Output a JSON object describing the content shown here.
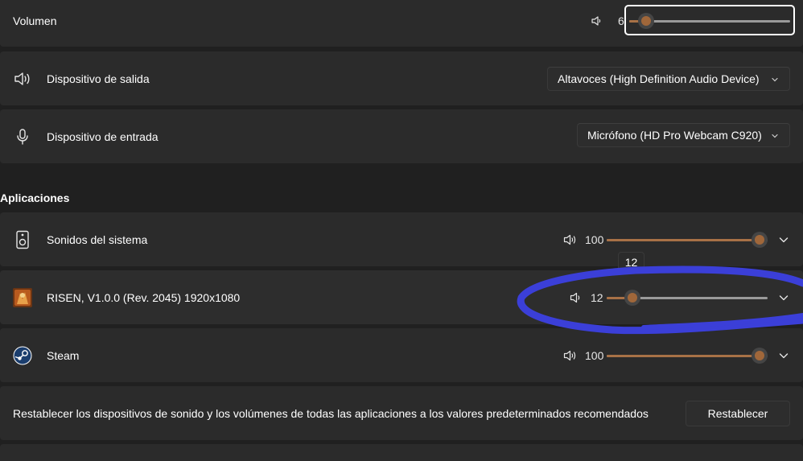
{
  "volume": {
    "label": "Volumen",
    "value": "6",
    "level": 6
  },
  "output_device": {
    "label": "Dispositivo de salida",
    "selected": "Altavoces (High Definition Audio Device)"
  },
  "input_device": {
    "label": "Dispositivo de entrada",
    "selected": "Micrófono (HD Pro Webcam C920)"
  },
  "apps_section": {
    "title": "Aplicaciones",
    "items": [
      {
        "name": "Sonidos del sistema",
        "value": "100",
        "level": 100,
        "icon": "system-speaker-icon"
      },
      {
        "name": "RISEN, V1.0.0 (Rev. 2045) 1920x1080",
        "value": "12",
        "level": 12,
        "icon": "risen-game-icon"
      },
      {
        "name": "Steam",
        "value": "100",
        "level": 100,
        "icon": "steam-icon"
      }
    ],
    "tooltip": "12"
  },
  "reset": {
    "description": "Restablecer los dispositivos de sonido y los volúmenes de todas las aplicaciones a los valores predeterminados recomendados",
    "button_label": "Restablecer"
  },
  "colors": {
    "background": "#202020",
    "card": "#2b2b2b",
    "accent": "#a0673a",
    "annotation": "#3b3fd8"
  }
}
